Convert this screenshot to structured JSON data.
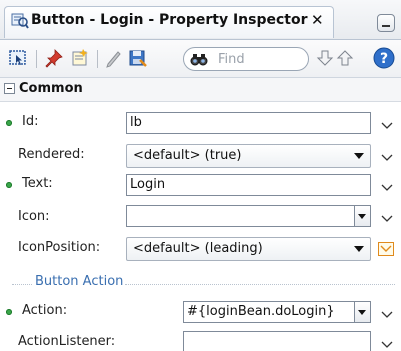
{
  "window": {
    "title": "Button - Login - Property Inspector",
    "close_glyph": "✕"
  },
  "toolbar": {
    "icons": [
      "select-icon",
      "pin-icon",
      "edit-props-icon",
      "pencil-icon",
      "bind-icon"
    ],
    "find_placeholder": "Find",
    "nav_down": "down-arrow-icon",
    "nav_up": "up-arrow-icon",
    "help": "?"
  },
  "section": {
    "title": "Common"
  },
  "properties": {
    "id": {
      "label": "Id:",
      "value": "lb"
    },
    "rendered": {
      "label": "Rendered:",
      "value": "<default> (true)"
    },
    "text": {
      "label": "Text:",
      "value": "Login"
    },
    "icon": {
      "label": "Icon:",
      "value": ""
    },
    "icon_position": {
      "label": "IconPosition:",
      "value": "<default> (leading)"
    }
  },
  "group": {
    "label": "Button Action"
  },
  "action_props": {
    "action": {
      "label": "Action:",
      "value": "#{loginBean.doLogin}"
    },
    "action_listener": {
      "label": "ActionListener:",
      "value": ""
    }
  },
  "colors": {
    "required_dot": "#3aa64a",
    "group_label": "#3a6fb0",
    "highlight": "#e08a1c"
  }
}
